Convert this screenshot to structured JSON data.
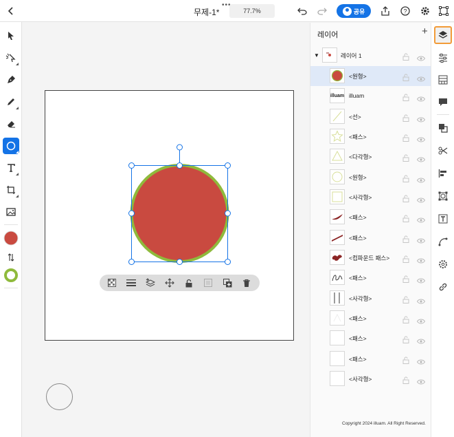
{
  "header": {
    "doc_title": "무제-1*",
    "zoom": "77.7%",
    "share_label": "공유"
  },
  "layers": {
    "title": "레이어",
    "parent_layer": "레이어 1",
    "items": [
      {
        "name": "<원형>"
      },
      {
        "name": "illuam",
        "thumb_text": "illuam"
      },
      {
        "name": "<선>"
      },
      {
        "name": "<패스>"
      },
      {
        "name": "<다각형>"
      },
      {
        "name": "<원형>"
      },
      {
        "name": "<사각형>"
      },
      {
        "name": "<패스>"
      },
      {
        "name": "<패스>"
      },
      {
        "name": "<컴파운드 패스>"
      },
      {
        "name": "<패스>"
      },
      {
        "name": "<사각형>"
      },
      {
        "name": "<패스>"
      },
      {
        "name": "<패스>"
      },
      {
        "name": "<패스>"
      },
      {
        "name": "<사각형>"
      }
    ]
  },
  "footer": {
    "copyright": "Copyright 2024 illuam. All Right Reserved."
  },
  "colors": {
    "fill": "#c94a40",
    "stroke": "#8fba3c",
    "accent": "#1473e6",
    "highlight": "#f29b38"
  }
}
